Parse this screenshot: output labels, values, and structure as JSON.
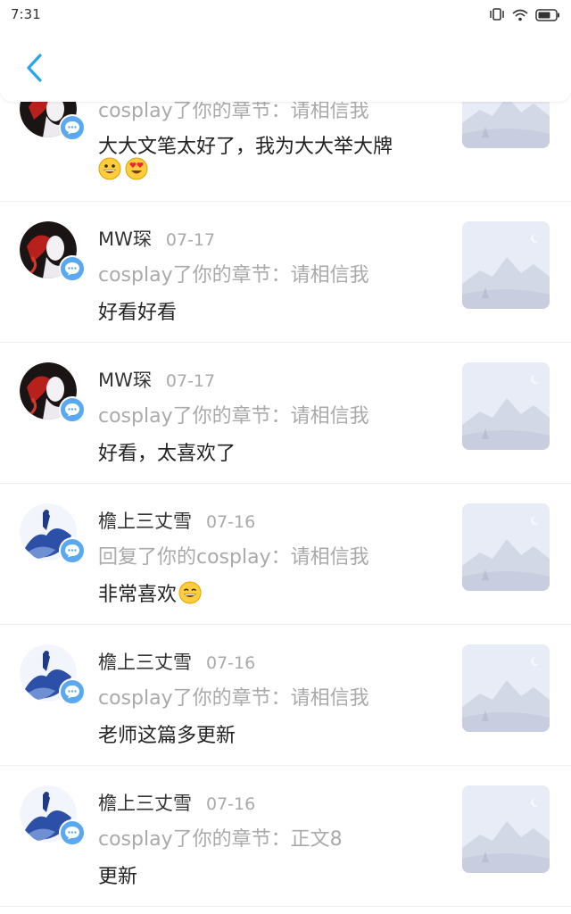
{
  "status_bar": {
    "time": "7:31",
    "icons": [
      "vibrate-icon",
      "wifi-icon",
      "battery-icon"
    ]
  },
  "header": {
    "back_icon": "chevron-left-icon",
    "accent_color": "#2aa3f0"
  },
  "items": [
    {
      "name": "",
      "date": "",
      "action": "cosplay了你的章节：请相信我",
      "comment": "大大文笔太好了，我为大大举大牌",
      "emojis": [
        "grinning-face-emoji",
        "heart-eyes-emoji"
      ]
    },
    {
      "name": "MW琛",
      "date": "07-17",
      "action": "cosplay了你的章节：请相信我",
      "comment": "好看好看",
      "emojis": []
    },
    {
      "name": "MW琛",
      "date": "07-17",
      "action": "cosplay了你的章节：请相信我",
      "comment": "好看，太喜欢了",
      "emojis": []
    },
    {
      "name": "檐上三丈雪",
      "date": "07-16",
      "action": "回复了你的cosplay：请相信我",
      "comment": "非常喜欢",
      "emojis": [
        "grinning-face-emoji"
      ]
    },
    {
      "name": "檐上三丈雪",
      "date": "07-16",
      "action": "cosplay了你的章节：请相信我",
      "comment": "老师这篇多更新",
      "emojis": []
    },
    {
      "name": "檐上三丈雪",
      "date": "07-16",
      "action": "cosplay了你的章节：正文8",
      "comment": "更新",
      "emojis": []
    }
  ]
}
